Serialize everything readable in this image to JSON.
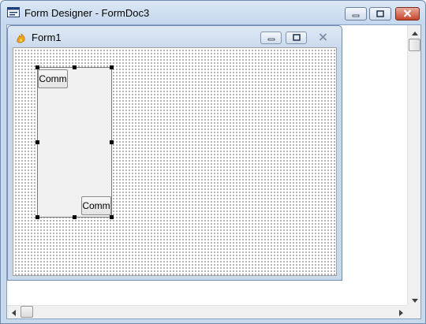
{
  "outer_window": {
    "title": "Form Designer - FormDoc3",
    "icon": "form-designer-icon",
    "caption_buttons": [
      "minimize",
      "maximize",
      "close"
    ]
  },
  "form_window": {
    "title": "Form1",
    "icon": "form-flame-icon",
    "caption_buttons": [
      "minimize",
      "maximize",
      "close"
    ]
  },
  "panel": {
    "selected": true,
    "buttons": [
      {
        "label": "Comm"
      },
      {
        "label": "Comm"
      }
    ]
  },
  "scrollbars": {
    "vertical": {
      "up_arrow": "arrow-up-icon",
      "down_arrow": "arrow-down-icon"
    },
    "horizontal": {
      "left_arrow": "arrow-left-icon",
      "right_arrow": "arrow-right-icon"
    }
  },
  "colors": {
    "titlebar": "#c9d9ec",
    "close_button": "#c7432b",
    "panel_background": "#f0f0f0",
    "grid_dots": "#000000"
  }
}
